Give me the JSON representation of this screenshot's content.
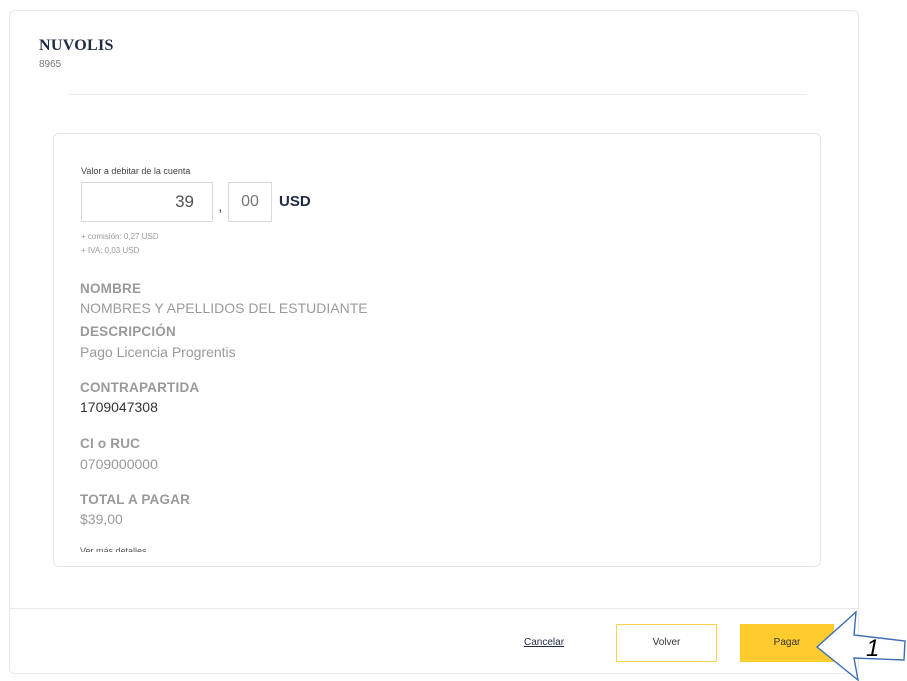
{
  "company": {
    "name": "NUVOLIS",
    "code": "8965"
  },
  "amount": {
    "label": "Valor a debitar de la cuenta",
    "integer": "39",
    "separator": ",",
    "decimals": "00",
    "currency": "USD",
    "commission": "+ comisión: 0,27 USD",
    "iva": "+ IVA: 0,03 USD"
  },
  "details": {
    "name_label": "NOMBRE",
    "name_value": "NOMBRES Y APELLIDOS DEL  ESTUDIANTE",
    "description_label": "DESCRIPCIÓN",
    "description_value": "Pago Licencia Progrentis",
    "counterpart_label": "CONTRAPARTIDA",
    "counterpart_value": "1709047308",
    "id_label": "CI o RUC",
    "id_value": "0709000000",
    "total_label": "TOTAL A PAGAR",
    "total_value": "$39,00",
    "more_link": "Ver más detalles"
  },
  "actions": {
    "cancel": "Cancelar",
    "back": "Volver",
    "pay": "Pagar"
  },
  "annotation": {
    "step": "1"
  },
  "colors": {
    "accent": "#ffcc2f",
    "brand_dark": "#1f2a44",
    "arrow": "#3b6eb5"
  }
}
